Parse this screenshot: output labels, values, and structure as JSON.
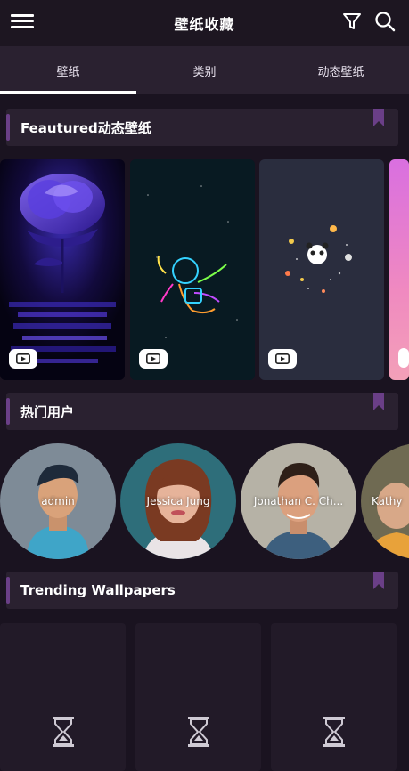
{
  "header": {
    "title": "壁纸收藏",
    "menu_icon": "hamburger-menu-icon",
    "filter_icon": "filter-icon",
    "search_icon": "search-icon"
  },
  "tabs": [
    {
      "label": "壁纸",
      "active": true
    },
    {
      "label": "类别",
      "active": false
    },
    {
      "label": "动态壁纸",
      "active": false
    }
  ],
  "sections": {
    "featured": {
      "title": "Feautured动态壁纸"
    },
    "popular_users": {
      "title": "热门用户"
    },
    "trending": {
      "title": "Trending Wallpapers"
    }
  },
  "featured_wallpapers": [
    {
      "subject": "purple rose",
      "icon": "video-play-icon"
    },
    {
      "subject": "neon astronaut",
      "icon": "video-play-icon"
    },
    {
      "subject": "panda astronaut in space",
      "icon": "video-play-icon"
    },
    {
      "subject": "pink gradient",
      "icon": "video-play-icon"
    }
  ],
  "users": [
    {
      "name": "admin"
    },
    {
      "name": "Jessica Jung"
    },
    {
      "name": "Jonathan C. Ch..."
    },
    {
      "name": "Kathy"
    }
  ],
  "trending_cards": [
    {
      "icon": "hourglass-loading-icon"
    },
    {
      "icon": "hourglass-loading-icon"
    },
    {
      "icon": "hourglass-loading-icon"
    }
  ],
  "colors": {
    "background": "#1a1320",
    "header_bg": "#2a2130",
    "accent": "#6a3f87",
    "tab_indicator": "#ffffff"
  }
}
